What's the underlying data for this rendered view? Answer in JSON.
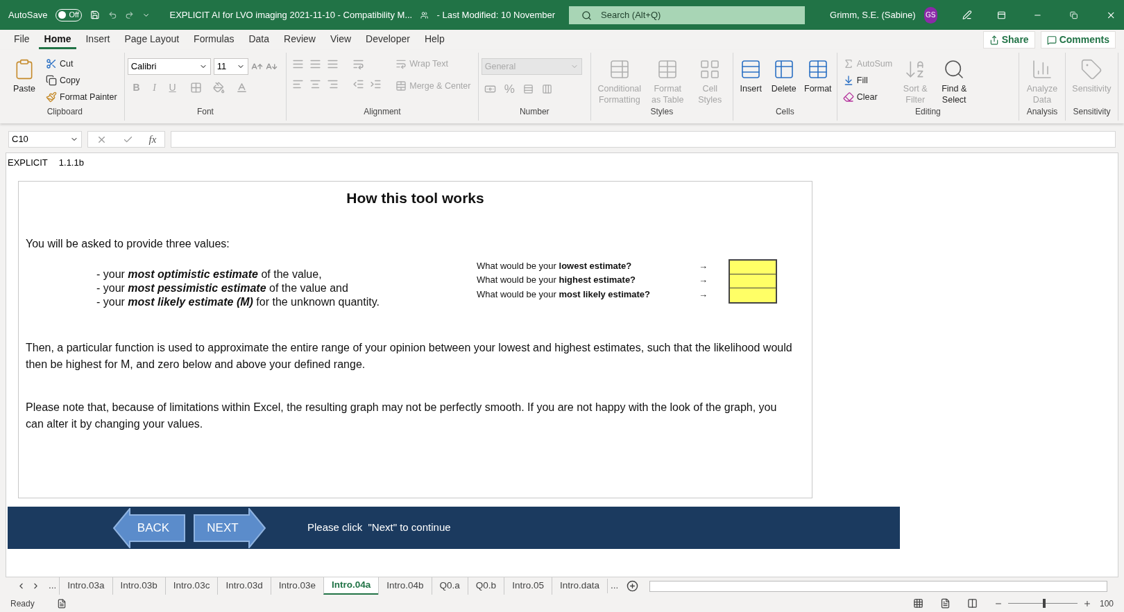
{
  "title_bar": {
    "autosave_label": "AutoSave",
    "autosave_state": "Off",
    "autosave_on": false,
    "document_title": "EXPLICIT AI for LVO imaging 2021-11-10  -  Compatibility M...",
    "last_modified": "-  Last Modified: 10 November",
    "search_placeholder": "Search (Alt+Q)",
    "user_name": "Grimm, S.E. (Sabine)",
    "user_initials": "GS"
  },
  "menu_tabs": [
    {
      "label": "File",
      "selected": false
    },
    {
      "label": "Home",
      "selected": true
    },
    {
      "label": "Insert",
      "selected": false
    },
    {
      "label": "Page Layout",
      "selected": false
    },
    {
      "label": "Formulas",
      "selected": false
    },
    {
      "label": "Data",
      "selected": false
    },
    {
      "label": "Review",
      "selected": false
    },
    {
      "label": "View",
      "selected": false
    },
    {
      "label": "Developer",
      "selected": false
    },
    {
      "label": "Help",
      "selected": false
    }
  ],
  "share_button": "Share",
  "comments_button": "Comments",
  "ribbon": {
    "clipboard": {
      "label": "Clipboard",
      "items": [
        {
          "label": "Paste",
          "disabled": false
        },
        {
          "label": "Cut",
          "disabled": false
        },
        {
          "label": "Copy",
          "disabled": false
        },
        {
          "label": "Format Painter",
          "disabled": false
        }
      ]
    },
    "font": {
      "label": "Font",
      "font_name": "Calibri",
      "font_size": "11",
      "items": [
        {
          "label": "B",
          "disabled": true
        },
        {
          "label": "I",
          "disabled": true
        },
        {
          "label": "U",
          "disabled": true
        }
      ]
    },
    "alignment": {
      "label": "Alignment",
      "items": [
        {
          "label": "Wrap Text",
          "disabled": true
        },
        {
          "label": "Merge & Center",
          "disabled": true
        }
      ]
    },
    "number": {
      "label": "Number",
      "format": "General",
      "items": [
        {
          "label": "%",
          "disabled": true
        }
      ]
    },
    "styles": {
      "label": "Styles",
      "items": [
        {
          "label": "Conditional Formatting",
          "disabled": true
        },
        {
          "label": "Format as Table",
          "disabled": true
        },
        {
          "label": "Cell Styles",
          "disabled": true
        }
      ]
    },
    "cells": {
      "label": "Cells",
      "items": [
        {
          "label": "Insert",
          "disabled": false
        },
        {
          "label": "Delete",
          "disabled": false
        },
        {
          "label": "Format",
          "disabled": false
        }
      ]
    },
    "editing": {
      "label": "Editing",
      "items": [
        {
          "label": "AutoSum",
          "disabled": true
        },
        {
          "label": "Fill",
          "disabled": false
        },
        {
          "label": "Clear",
          "disabled": false
        },
        {
          "label": "Sort & Filter",
          "disabled": true
        },
        {
          "label": "Find & Select",
          "disabled": false
        }
      ]
    },
    "analysis": {
      "label": "Analysis",
      "items": [
        {
          "label": "Analyze Data",
          "disabled": true
        }
      ]
    },
    "sensitivity": {
      "label": "Sensitivity",
      "items": [
        {
          "label": "Sensitivity",
          "disabled": true
        }
      ]
    }
  },
  "formula_bar": {
    "name_box": "C10",
    "function_label": "fx"
  },
  "sheet": {
    "cell_label": "EXPLICIT",
    "cell_version": "1.1.1b",
    "card": {
      "title": "How this tool works",
      "intro": "You will be asked to provide three values:",
      "bullets": [
        {
          "lead": "- your",
          "emphasis": "most optimistic estimate",
          "rest": "of the value,"
        },
        {
          "lead": "- your",
          "emphasis": "most pessimistic estimate",
          "rest": "of the value and"
        },
        {
          "lead": "- your",
          "emphasis": "most likely estimate (M)",
          "rest": "for the unknown quantity."
        }
      ],
      "questions": [
        {
          "lead": "What would be your",
          "emphasis": "lowest estimate?",
          "arrow": "→"
        },
        {
          "lead": "What would be your",
          "emphasis": "highest estimate?",
          "arrow": "→"
        },
        {
          "lead": "What would be your",
          "emphasis": "most likely estimate?",
          "arrow": "→"
        }
      ],
      "paragraphs": [
        "Then, a particular function is used to approximate the entire range of your opinion between your lowest and highest estimates, such that the likelihood would then be highest for M, and zero below and above your defined range.",
        "Please note that, because of limitations within Excel, the resulting graph may not be perfectly smooth. If you are not happy with the look of the graph, you can alter it by changing your values."
      ]
    },
    "nav": {
      "back": "BACK",
      "next": "NEXT",
      "hint": "Please click  \"Next\" to continue"
    }
  },
  "sheet_tabs": {
    "leading_more": "...",
    "trailing_more": "...",
    "tabs": [
      {
        "label": "Intro.03a",
        "selected": false
      },
      {
        "label": "Intro.03b",
        "selected": false
      },
      {
        "label": "Intro.03c",
        "selected": false
      },
      {
        "label": "Intro.03d",
        "selected": false
      },
      {
        "label": "Intro.03e",
        "selected": false
      },
      {
        "label": "Intro.04a",
        "selected": true
      },
      {
        "label": "Intro.04b",
        "selected": false
      },
      {
        "label": "Q0.a",
        "selected": false
      },
      {
        "label": "Q0.b",
        "selected": false
      },
      {
        "label": "Intro.05",
        "selected": false
      },
      {
        "label": "Intro.data",
        "selected": false
      }
    ]
  },
  "status_bar": {
    "status": "Ready",
    "zoom": "100",
    "zoom_level": {
      "level": 0.5
    }
  }
}
